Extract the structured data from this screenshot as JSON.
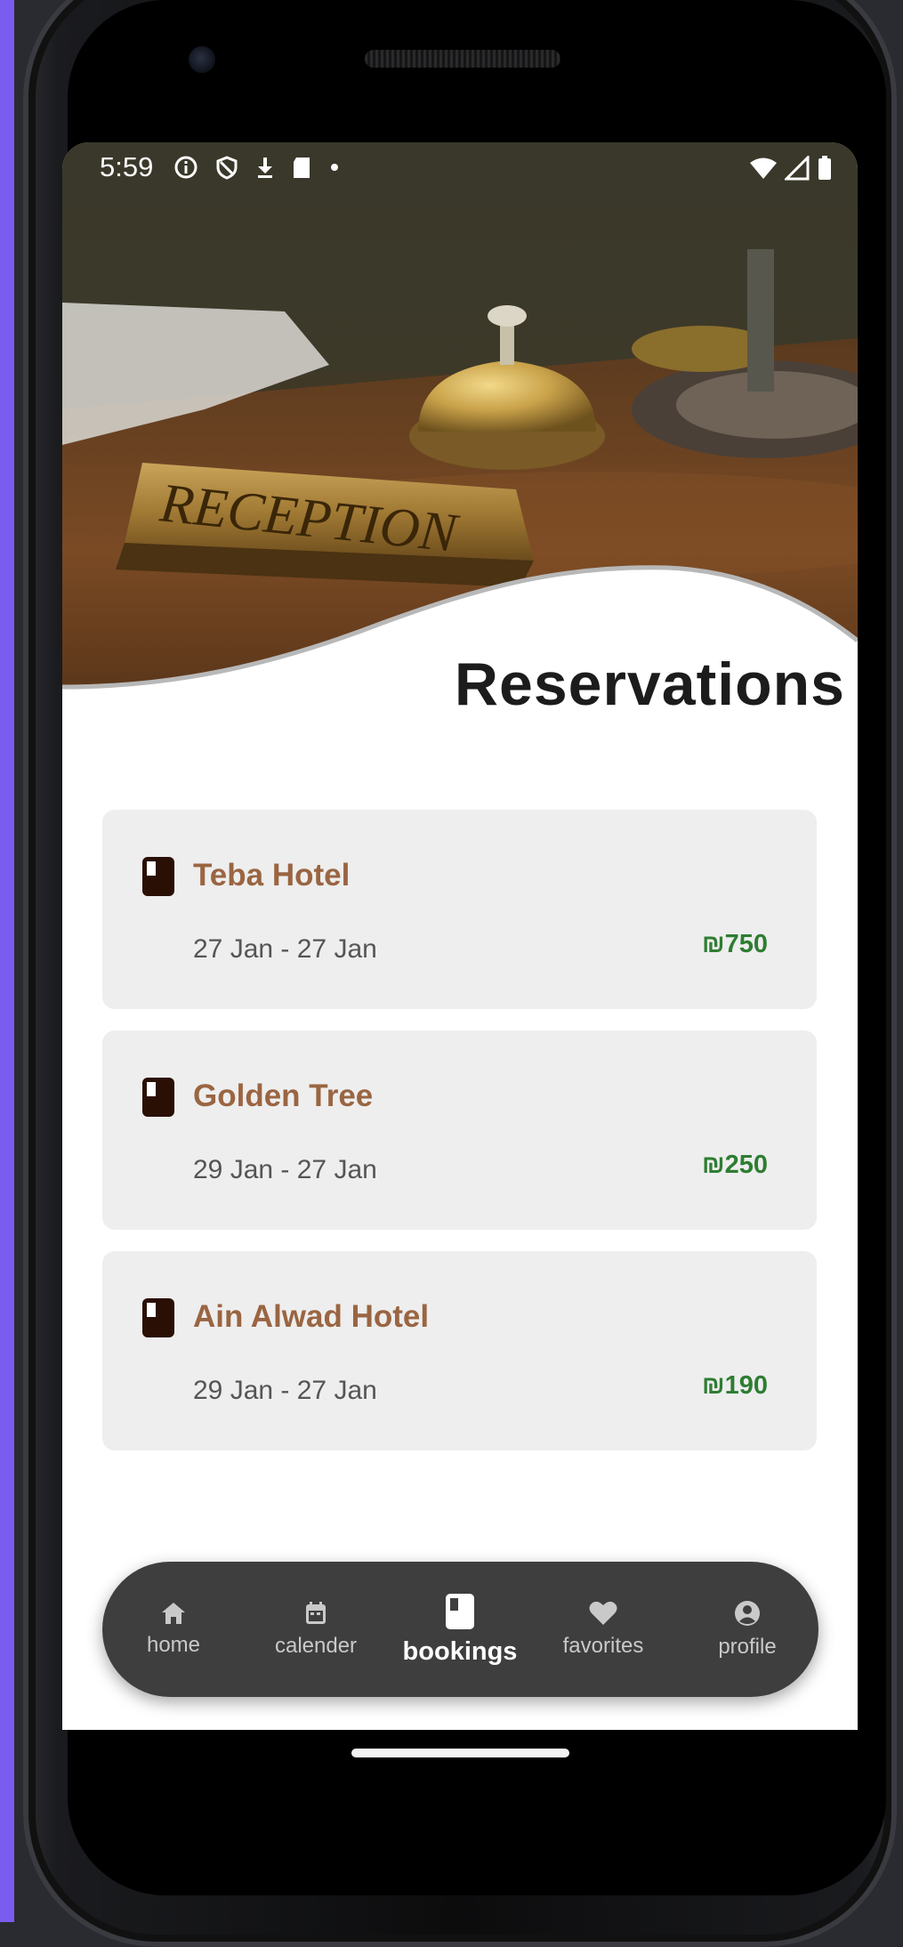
{
  "status_bar": {
    "time": "5:59",
    "left_icons": [
      "info-icon",
      "shield-icon",
      "download-icon",
      "sd-card-icon",
      "dot-icon"
    ],
    "right_icons": [
      "wifi-icon",
      "signal-icon",
      "battery-icon"
    ]
  },
  "hero": {
    "image": "reception-desk-bell-photo",
    "sign_text": "RECEPTION",
    "title": "Reservations"
  },
  "reservations": [
    {
      "name": "Teba Hotel",
      "dates": "27 Jan - 27 Jan",
      "price": "₪750",
      "icon": "booking-icon"
    },
    {
      "name": "Golden Tree",
      "dates": "29 Jan - 27 Jan",
      "price": "₪250",
      "icon": "booking-icon"
    },
    {
      "name": "Ain Alwad Hotel",
      "dates": "29 Jan - 27 Jan",
      "price": "₪190",
      "icon": "booking-icon"
    }
  ],
  "bottom_nav": {
    "items": [
      {
        "label": "home",
        "icon": "home-icon"
      },
      {
        "label": "calender",
        "icon": "calendar-icon"
      },
      {
        "label": "bookings",
        "icon": "bookings-icon"
      },
      {
        "label": "favorites",
        "icon": "heart-icon"
      },
      {
        "label": "profile",
        "icon": "profile-icon"
      }
    ],
    "active": "bookings"
  },
  "colors": {
    "hotel_name": "#9a6542",
    "price": "#2e7d32",
    "card_bg": "#eeeeee",
    "nav_bg": "#3e3e3e",
    "accent_left_edge": "#7b5cf0"
  }
}
